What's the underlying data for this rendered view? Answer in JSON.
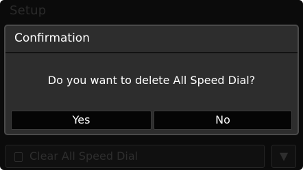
{
  "background": {
    "title": "Setup",
    "row_label": "Clear All Speed Dial",
    "scroll_symbol": "▼"
  },
  "dialog": {
    "title": "Confirmation",
    "message": "Do you want to delete All Speed Dial?",
    "yes_label": "Yes",
    "no_label": "No"
  },
  "colors": {
    "screen_background": "#0b0b0b",
    "dialog_background": "#2d2d2d",
    "button_background": "#050505",
    "text": "#ffffff"
  }
}
